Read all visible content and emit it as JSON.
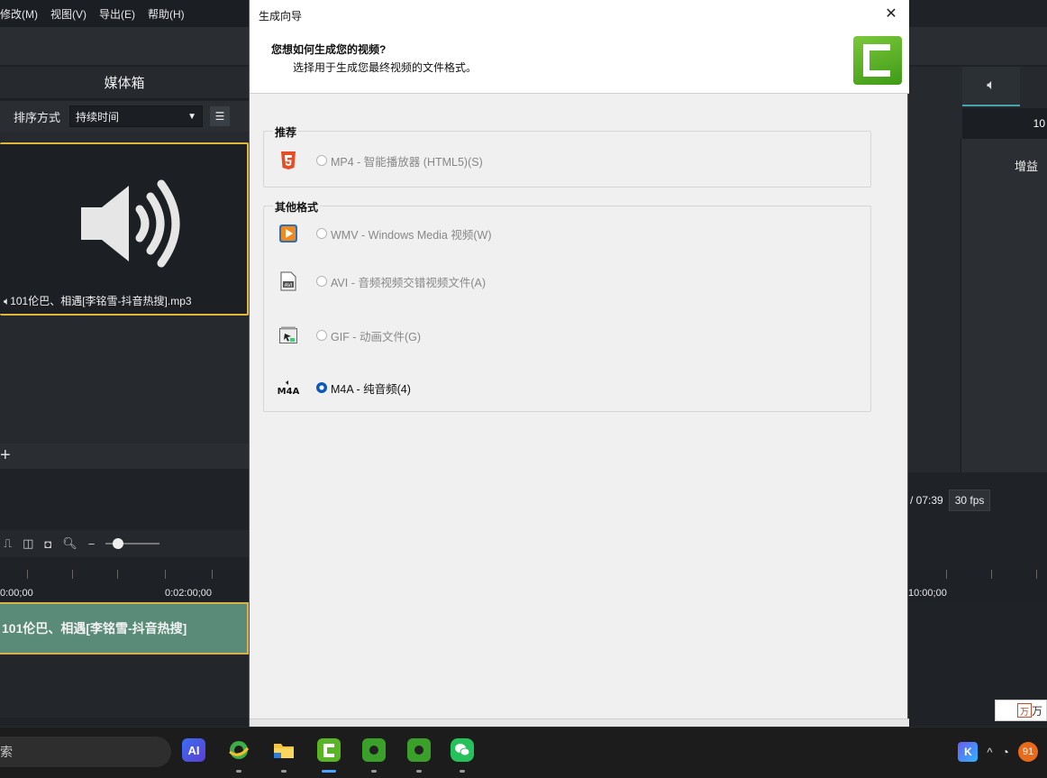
{
  "app": {
    "menu": [
      "修改(M)",
      "视图(V)",
      "导出(E)",
      "帮助(H)"
    ],
    "media_bin": {
      "title": "媒体箱",
      "sort_label": "排序方式",
      "sort_value": "持续时间",
      "file_name": "101伦巴、相遇[李铭雪-抖音热搜].mp3"
    },
    "right_panel": {
      "bar_text": "10",
      "gain_label": "增益"
    },
    "transport": {
      "time_total": "/ 07:39",
      "fps": "30 fps"
    },
    "timeline": {
      "ticks": [
        "0:00;00",
        "0:02:00;00",
        "10:00;00"
      ],
      "clip_label": "101伦巴、相遇[李铭雪-抖音热搜]"
    },
    "ad_widget_text": "万"
  },
  "dialog": {
    "title": "生成向导",
    "question": "您想如何生成您的视频?",
    "subtitle": "选择用于生成您最终视频的文件格式。",
    "groups": {
      "recommended": {
        "title": "推荐",
        "options": [
          {
            "label": "MP4 - 智能播放器 (HTML5)(S)",
            "selected": false,
            "icon": "html5-icon"
          }
        ]
      },
      "other": {
        "title": "其他格式",
        "options": [
          {
            "label": "WMV - Windows Media 视频(W)",
            "selected": false,
            "icon": "wmv-icon"
          },
          {
            "label": "AVI - 音频视频交错视频文件(A)",
            "selected": false,
            "icon": "avi-icon"
          },
          {
            "label": "GIF - 动画文件(G)",
            "selected": false,
            "icon": "gif-icon"
          },
          {
            "label": "M4A - 纯音频(4)",
            "selected": true,
            "icon": "m4a-icon"
          }
        ]
      }
    },
    "m4a_icon_text": "M4A",
    "avi_icon_text": "AVI"
  },
  "taskbar": {
    "search_text": "索",
    "ai_label": "AI",
    "notification_count": "91",
    "k_label": "K"
  },
  "colors": {
    "accent_gold": "#e0b63a",
    "clip_green": "#5a8a78",
    "radio_blue": "#0a58b8",
    "camtasia_green": "#5ab526"
  }
}
